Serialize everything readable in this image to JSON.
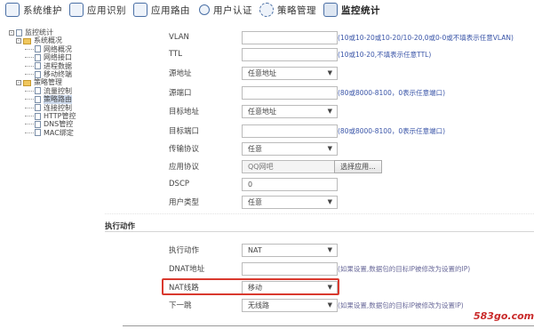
{
  "toolbar": {
    "items": [
      {
        "label": "系统维护",
        "icon": "settings-icon"
      },
      {
        "label": "应用识别",
        "icon": "app-icon"
      },
      {
        "label": "应用路由",
        "icon": "route-icon"
      },
      {
        "label": "用户认证",
        "icon": "user-icon"
      },
      {
        "label": "策略管理",
        "icon": "gear-icon"
      },
      {
        "label": "监控统计",
        "icon": "monitor-icon"
      }
    ]
  },
  "tree": {
    "root": "监控统计",
    "groups": [
      {
        "label": "系统概况",
        "items": [
          "网络概况",
          "网络接口",
          "进程数据",
          "移动终端"
        ]
      },
      {
        "label": "策略管理",
        "items": [
          "流量控制",
          "策略路由",
          "连接控制",
          "HTTP管控",
          "DNS管控",
          "MAC绑定"
        ]
      }
    ],
    "selected": "策略路由"
  },
  "form": {
    "vlan": {
      "label": "VLAN",
      "value": "",
      "hint": "(10或10-20或10-20/10-20,0或0-0或不填表示任意VLAN)"
    },
    "ttl": {
      "label": "TTL",
      "value": "",
      "hint": "(10或10-20,不填表示任意TTL)"
    },
    "src_addr": {
      "label": "源地址",
      "value": "任意地址"
    },
    "src_port": {
      "label": "源端口",
      "value": "",
      "hint": "(80或8000-8100，0表示任意端口)"
    },
    "dst_addr": {
      "label": "目标地址",
      "value": "任意地址"
    },
    "dst_port": {
      "label": "目标端口",
      "value": "",
      "hint": "(80或8000-8100，0表示任意端口)"
    },
    "protocol": {
      "label": "传输协议",
      "value": "任意"
    },
    "app_protocol": {
      "label": "应用协议",
      "value": "QQ网吧",
      "button": "选择应用..."
    },
    "dscp": {
      "label": "DSCP",
      "value": "0"
    },
    "user_type": {
      "label": "用户类型",
      "value": "任意"
    },
    "section": "执行动作",
    "action": {
      "label": "执行动作",
      "value": "NAT"
    },
    "dnat": {
      "label": "DNAT地址",
      "value": "",
      "hint": "(如果设置,数据包的目标IP被修改为设置的IP)"
    },
    "nat_line": {
      "label": "NAT线路",
      "value": "移动"
    },
    "next_hop": {
      "label": "下一跳",
      "value": "无线路",
      "hint": "(如果设置,数据包的目标IP被修改为设置IP)"
    }
  },
  "watermark": "583go.com"
}
